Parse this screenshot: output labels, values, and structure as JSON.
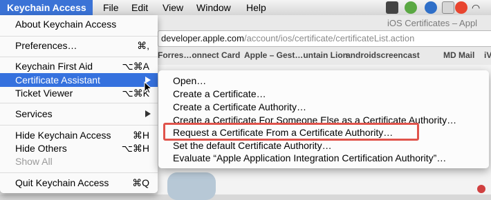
{
  "menubar": {
    "app_name": "Keychain Access",
    "items": [
      "File",
      "Edit",
      "View",
      "Window",
      "Help"
    ],
    "status_icons": [
      "camera-icon",
      "evernote-icon",
      "sync-icon",
      "keynote-icon",
      "meetup-icon",
      "wifi-icon"
    ],
    "accent": "#3b73d6"
  },
  "browser": {
    "window_title": "iOS Certificates – Appl",
    "url_host": "developer.apple.com",
    "url_path": "/account/ios/certificate/certificateList.action",
    "bookmarks": [
      "Forres…onnect Card",
      "Apple – Gest…untain Lion",
      "androidscreencast",
      "MD Mail",
      "iV"
    ]
  },
  "menu": {
    "items": [
      {
        "label": "About Keychain Access",
        "shortcut": ""
      },
      {
        "label": "Preferences…",
        "shortcut": "⌘,"
      },
      {
        "label": "Keychain First Aid",
        "shortcut": "⌥⌘A"
      },
      {
        "label": "Certificate Assistant",
        "shortcut": ""
      },
      {
        "label": "Ticket Viewer",
        "shortcut": "⌥⌘K"
      },
      {
        "label": "Services",
        "shortcut": ""
      },
      {
        "label": "Hide Keychain Access",
        "shortcut": "⌘H"
      },
      {
        "label": "Hide Others",
        "shortcut": "⌥⌘H"
      },
      {
        "label": "Show All",
        "shortcut": ""
      },
      {
        "label": "Quit Keychain Access",
        "shortcut": "⌘Q"
      }
    ],
    "highlight_color": "#3571de"
  },
  "submenu": {
    "items": [
      "Open…",
      "Create a Certificate…",
      "Create a Certificate Authority…",
      "Create a Certificate For Someone Else as a Certificate Authority…",
      "Request a Certificate From a Certificate Authority…",
      "Set the default Certificate Authority…",
      "Evaluate “Apple Application Integration Certification Authority”…"
    ],
    "annotation_color": "#e0534b"
  }
}
